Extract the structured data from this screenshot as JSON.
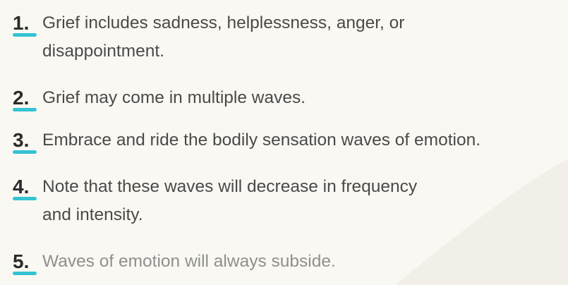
{
  "accent_color": "#33c3d4",
  "items": [
    {
      "number": "1.",
      "line1": "Grief includes sadness, helplessness, anger, or",
      "line2": "disappointment."
    },
    {
      "number": "2.",
      "line1": "Grief may come in multiple waves."
    },
    {
      "number": "3.",
      "line1": "Embrace and ride the bodily sensation waves of emotion."
    },
    {
      "number": "4.",
      "line1": "Note that these waves will decrease in frequency",
      "line2": "and intensity."
    },
    {
      "number": "5.",
      "line1": "Waves of emotion will always subside."
    }
  ]
}
